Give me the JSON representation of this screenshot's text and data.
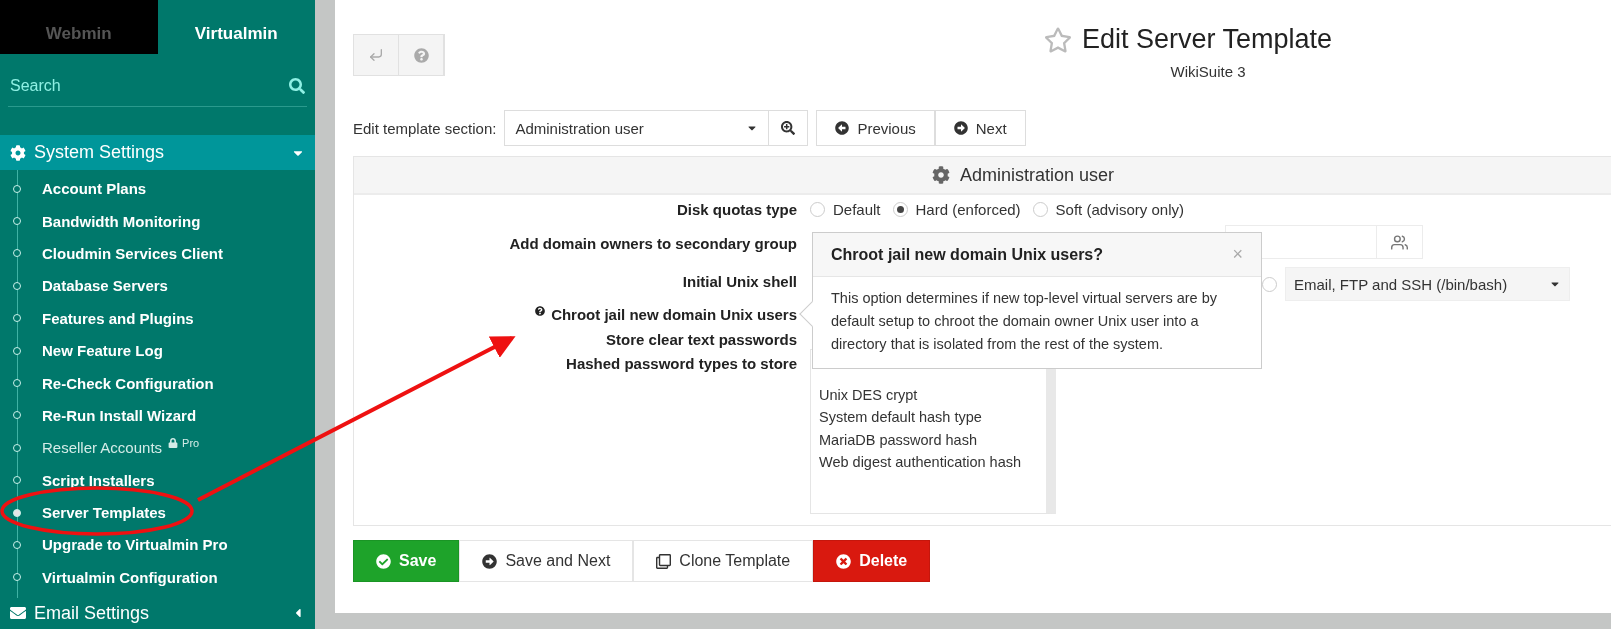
{
  "sidebar": {
    "tabs": [
      {
        "label": "Webmin",
        "selected": false
      },
      {
        "label": "Virtualmin",
        "selected": true
      }
    ],
    "search": {
      "placeholder": "Search"
    },
    "categories": [
      {
        "label": "System Settings",
        "expanded": true,
        "items": [
          {
            "label": "Account Plans",
            "selected": false,
            "locked": false
          },
          {
            "label": "Bandwidth Monitoring",
            "selected": false,
            "locked": false
          },
          {
            "label": "Cloudmin Services Client",
            "selected": false,
            "locked": false
          },
          {
            "label": "Database Servers",
            "selected": false,
            "locked": false
          },
          {
            "label": "Features and Plugins",
            "selected": false,
            "locked": false
          },
          {
            "label": "New Feature Log",
            "selected": false,
            "locked": false
          },
          {
            "label": "Re-Check Configuration",
            "selected": false,
            "locked": false
          },
          {
            "label": "Re-Run Install Wizard",
            "selected": false,
            "locked": false
          },
          {
            "label": "Reseller Accounts",
            "selected": false,
            "locked": true,
            "badge": "Pro"
          },
          {
            "label": "Script Installers",
            "selected": false,
            "locked": false
          },
          {
            "label": "Server Templates",
            "selected": true,
            "locked": false
          },
          {
            "label": "Upgrade to Virtualmin Pro",
            "selected": false,
            "locked": false
          },
          {
            "label": "Virtualmin Configuration",
            "selected": false,
            "locked": false
          }
        ]
      },
      {
        "label": "Email Settings",
        "expanded": false
      }
    ]
  },
  "header": {
    "title": "Edit Server Template",
    "subtitle": "WikiSuite 3"
  },
  "section_picker": {
    "label": "Edit template section:",
    "value": "Administration user",
    "buttons": [
      {
        "kind": "previous",
        "label": "Previous"
      },
      {
        "kind": "next",
        "label": "Next"
      }
    ]
  },
  "panel": {
    "title": "Administration user",
    "rows": [
      {
        "kind": "radio",
        "label": "Disk quotas type",
        "options": [
          {
            "label": "Default",
            "selected": false
          },
          {
            "label": "Hard (enforced)",
            "selected": true
          },
          {
            "label": "Soft (advisory only)",
            "selected": false
          }
        ]
      },
      {
        "kind": "group",
        "label": "Add domain owners to secondary group"
      },
      {
        "kind": "shell",
        "label": "Initial Unix shell",
        "selected": false,
        "value": "Email, FTP and SSH (/bin/bash)"
      },
      {
        "kind": "help",
        "label": "Chroot jail new domain Unix users"
      },
      {
        "kind": "plain",
        "label": "Store clear text passwords"
      },
      {
        "kind": "list",
        "label": "Hashed password types to store",
        "options": [
          "Unix DES crypt",
          "System default hash type",
          "MariaDB password hash",
          "Web digest authentication hash"
        ]
      }
    ]
  },
  "popover": {
    "title": "Chroot jail new domain Unix users?",
    "close": "×",
    "text": "This option determines if new top-level virtual servers are by default setup to chroot the domain owner Unix user into a directory that is isolated from the rest of the system."
  },
  "actions": [
    {
      "kind": "save",
      "label": "Save"
    },
    {
      "kind": "next",
      "label": "Save and Next"
    },
    {
      "kind": "clone",
      "label": "Clone Template"
    },
    {
      "kind": "delete",
      "label": "Delete"
    }
  ]
}
